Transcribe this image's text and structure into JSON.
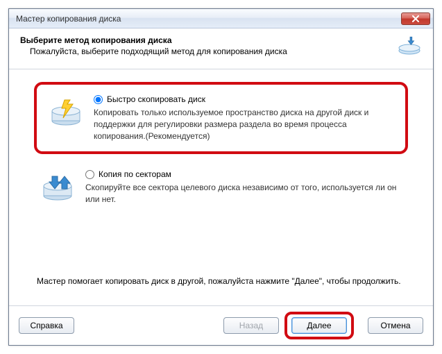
{
  "window": {
    "title": "Мастер копирования диска"
  },
  "header": {
    "heading": "Выберите метод копирования диска",
    "subheading": "Пожалуйста, выберите подходящий метод для копирования диска"
  },
  "options": {
    "fast": {
      "label": "Быстро скопировать диск",
      "description": "Копировать только используемое пространство диска на другой диск и поддержки для регулировки размера раздела во время процесса копирования.(Рекомендуется)",
      "checked": true
    },
    "sector": {
      "label": "Копия по секторам",
      "description": "Скопируйте все сектора целевого диска независимо от того, используется ли он или нет.",
      "checked": false
    }
  },
  "hint": "Мастер помогает копировать диск в другой, пожалуйста нажмите \"Далее\", чтобы продолжить.",
  "buttons": {
    "help": "Справка",
    "back": "Назад",
    "next": "Далее",
    "cancel": "Отмена"
  }
}
